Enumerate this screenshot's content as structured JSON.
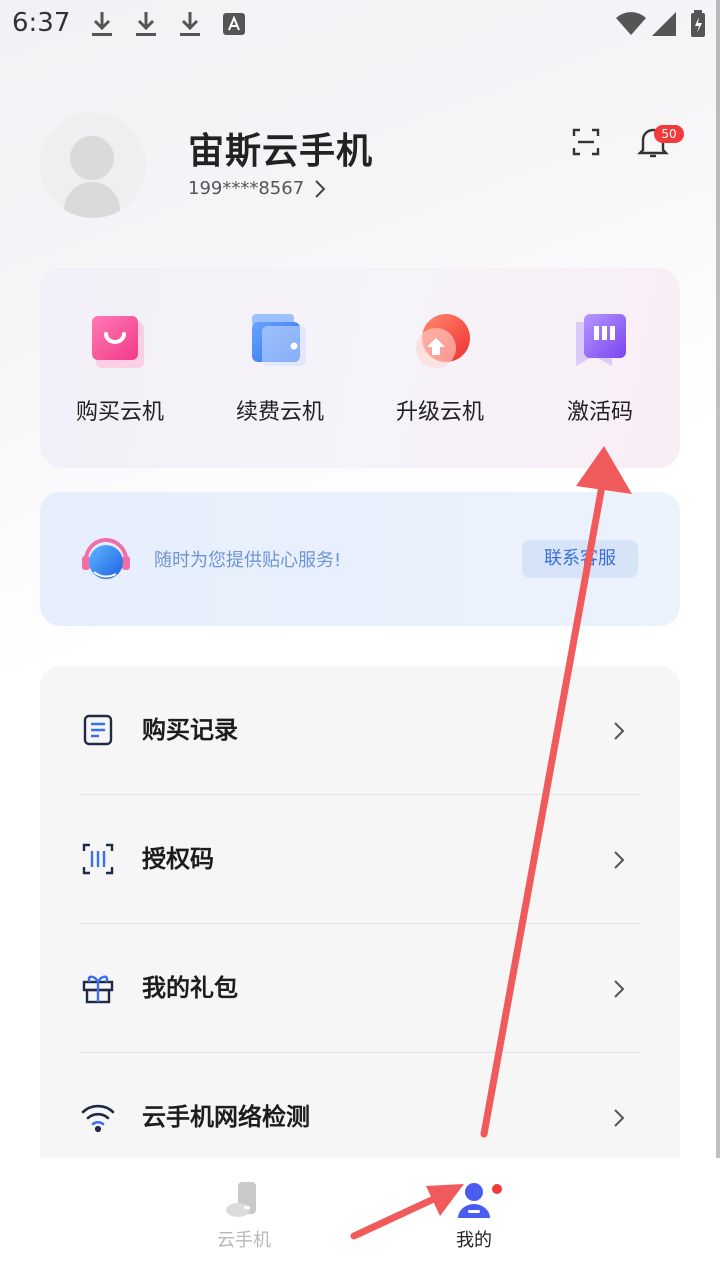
{
  "status_bar": {
    "time": "6:37",
    "left_icons": [
      "download-icon",
      "download-icon",
      "download-icon",
      "font-a-icon"
    ],
    "right_icons": [
      "wifi-icon",
      "signal-icon",
      "battery-icon"
    ]
  },
  "header": {
    "user_name": "宙斯云手机",
    "phone": "199****8567",
    "notification_count": "50",
    "icons": [
      "scan-icon",
      "bell-icon",
      "chevron-right-icon"
    ]
  },
  "quick_actions": [
    {
      "label": "购买云机",
      "icon": "shopping-bag-icon",
      "color": "#f0509a"
    },
    {
      "label": "续费云机",
      "icon": "wallet-icon",
      "color": "#3b7ef2"
    },
    {
      "label": "升级云机",
      "icon": "upgrade-icon",
      "color": "#f24b3f"
    },
    {
      "label": "激活码",
      "icon": "activation-code-icon",
      "color": "#8a5cf0"
    }
  ],
  "service": {
    "text": "随时为您提供贴心服务!",
    "button": "联系客服",
    "icon": "headset-icon"
  },
  "menu": [
    {
      "label": "购买记录",
      "icon": "document-icon"
    },
    {
      "label": "授权码",
      "icon": "scan-code-icon"
    },
    {
      "label": "我的礼包",
      "icon": "gift-icon"
    },
    {
      "label": "云手机网络检测",
      "icon": "wifi-icon"
    }
  ],
  "tabs": [
    {
      "label": "云手机",
      "icon": "cloud-phone-icon",
      "active": false
    },
    {
      "label": "我的",
      "icon": "profile-icon",
      "active": true
    }
  ],
  "colors": {
    "accent": "#4a5cf0",
    "badge": "#f23a3a",
    "annotation_arrow": "#f05a5a"
  }
}
